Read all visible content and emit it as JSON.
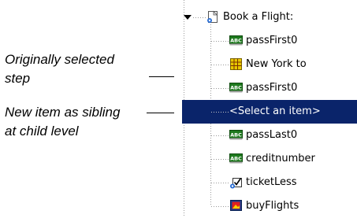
{
  "callouts": {
    "original_line1": "Originally selected",
    "original_line2": "step",
    "new_line1": "New item as sibling",
    "new_line2": "at child level"
  },
  "tree": {
    "root": {
      "label": "Book a Flight:",
      "icon": "page-icon"
    },
    "items": [
      {
        "label": "passFirst0",
        "icon": "edit-field-icon"
      },
      {
        "label": "New York to",
        "icon": "grid-table-icon"
      },
      {
        "label": "passFirst0",
        "icon": "edit-field-icon"
      },
      {
        "label": "<Select an item>",
        "icon": "",
        "selected": true
      },
      {
        "label": "passLast0",
        "icon": "edit-field-icon"
      },
      {
        "label": "creditnumber",
        "icon": "edit-field-icon"
      },
      {
        "label": "ticketLess",
        "icon": "checkbox-icon"
      },
      {
        "label": "buyFlights",
        "icon": "image-button-icon"
      }
    ]
  },
  "colors": {
    "selection": "#0a246a",
    "field_icon": "#1f7a1f",
    "grid_icon": "#e8c800"
  }
}
